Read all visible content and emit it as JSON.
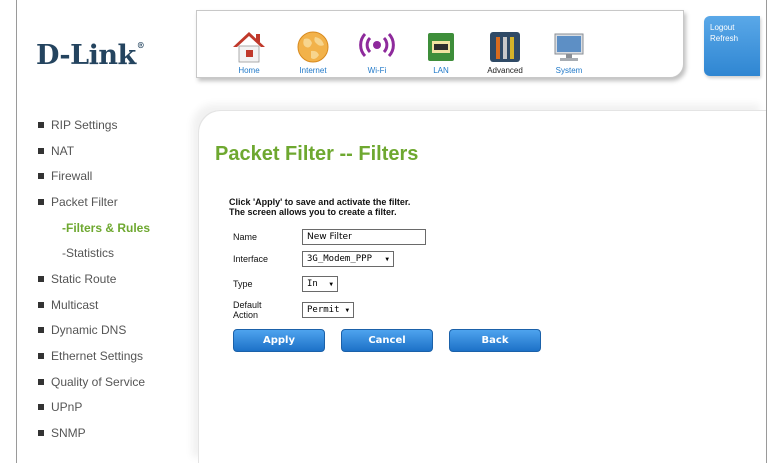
{
  "header": {
    "logo": "D-Link",
    "logo_reg": "®",
    "toolbar": [
      {
        "label": "Home",
        "icon": "home-icon"
      },
      {
        "label": "Internet",
        "icon": "globe-icon"
      },
      {
        "label": "Wi-Fi",
        "icon": "wifi-icon"
      },
      {
        "label": "LAN",
        "icon": "lan-icon"
      },
      {
        "label": "Advanced",
        "icon": "tools-icon"
      },
      {
        "label": "System",
        "icon": "computer-icon"
      }
    ],
    "logout": "Logout",
    "refresh": "Refresh"
  },
  "nav": {
    "items": [
      {
        "label": "RIP Settings"
      },
      {
        "label": "NAT"
      },
      {
        "label": "Firewall"
      },
      {
        "label": "Packet Filter"
      },
      {
        "label": "-Filters & Rules",
        "sub": true,
        "active": true
      },
      {
        "label": "-Statistics",
        "sub": true
      },
      {
        "label": "Static Route"
      },
      {
        "label": "Multicast"
      },
      {
        "label": "Dynamic DNS"
      },
      {
        "label": "Ethernet Settings"
      },
      {
        "label": "Quality of Service"
      },
      {
        "label": "UPnP"
      },
      {
        "label": "SNMP"
      }
    ]
  },
  "main": {
    "title": "Packet Filter -- Filters",
    "instructions_1": "Click 'Apply' to save and activate the filter.",
    "instructions_2": "The screen allows you to create a filter.",
    "fields": {
      "name_label": "Name",
      "name_value": "New Filter",
      "interface_label": "Interface",
      "interface_value": "3G_Modem_PPP",
      "type_label": "Type",
      "type_value": "In",
      "action_label": "Default Action",
      "action_value": "Permit"
    },
    "buttons": {
      "apply": "Apply",
      "cancel": "Cancel",
      "back": "Back"
    }
  },
  "colors": {
    "accent_green": "#6ea830",
    "button_blue": "#1d71c7",
    "logo_navy": "#24445f"
  }
}
